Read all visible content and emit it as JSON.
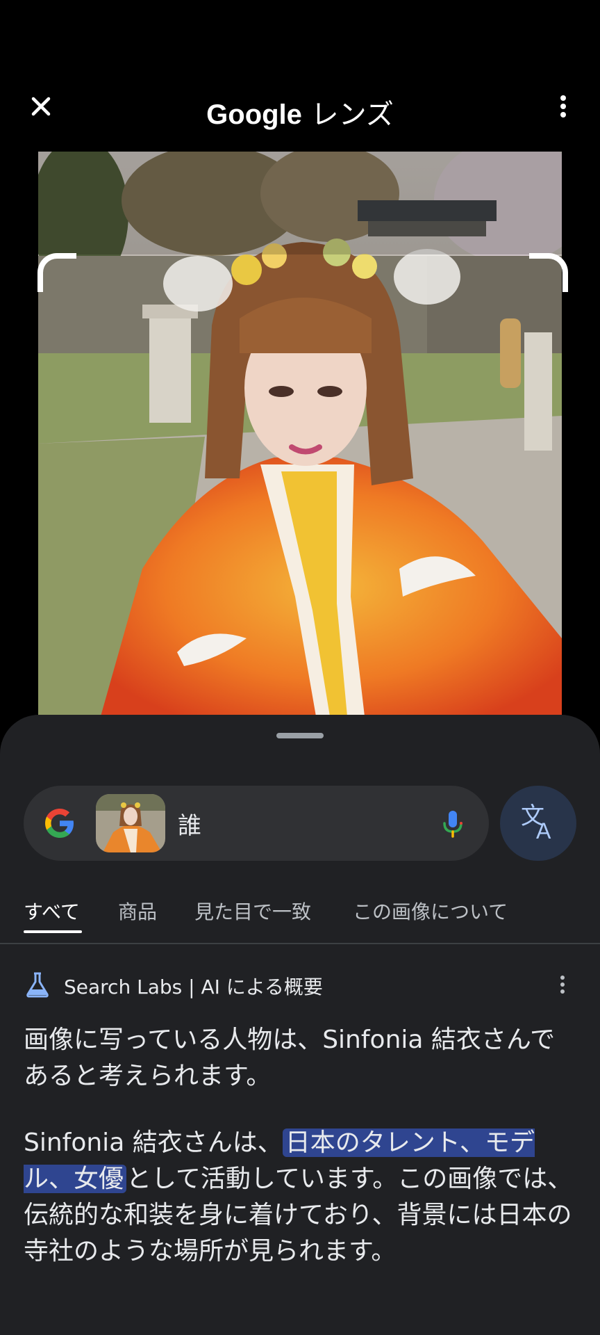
{
  "header": {
    "title_brand": "Google",
    "title_suffix": "レンズ",
    "close_icon": "close-icon",
    "more_icon": "more-vert-icon"
  },
  "search": {
    "query": "誰",
    "thumbnail": "query-image-thumbnail",
    "mic_icon": "mic-icon",
    "translate_icon": "translate-icon"
  },
  "tabs": [
    {
      "label": "すべて",
      "active": true
    },
    {
      "label": "商品",
      "active": false
    },
    {
      "label": "見た目で一致",
      "active": false
    },
    {
      "label": "この画像について",
      "active": false
    }
  ],
  "ai_overview": {
    "title": "Search Labs | AI による概要",
    "paragraph1": "画像に写っている人物は、Sinfonia 結衣さんであると考えられます。",
    "paragraph2_before": "Sinfonia 結衣さんは、",
    "paragraph2_highlight": "日本のタレント、モデル、女優",
    "paragraph2_after": "として活動しています。この画像では、伝統的な和装を身に着けており、背景には日本の寺社のような場所が見られます。"
  },
  "colors": {
    "background": "#000000",
    "sheet": "#202124",
    "search_bar": "#303134",
    "highlight": "#2f4590",
    "translate_button": "#28344a"
  }
}
